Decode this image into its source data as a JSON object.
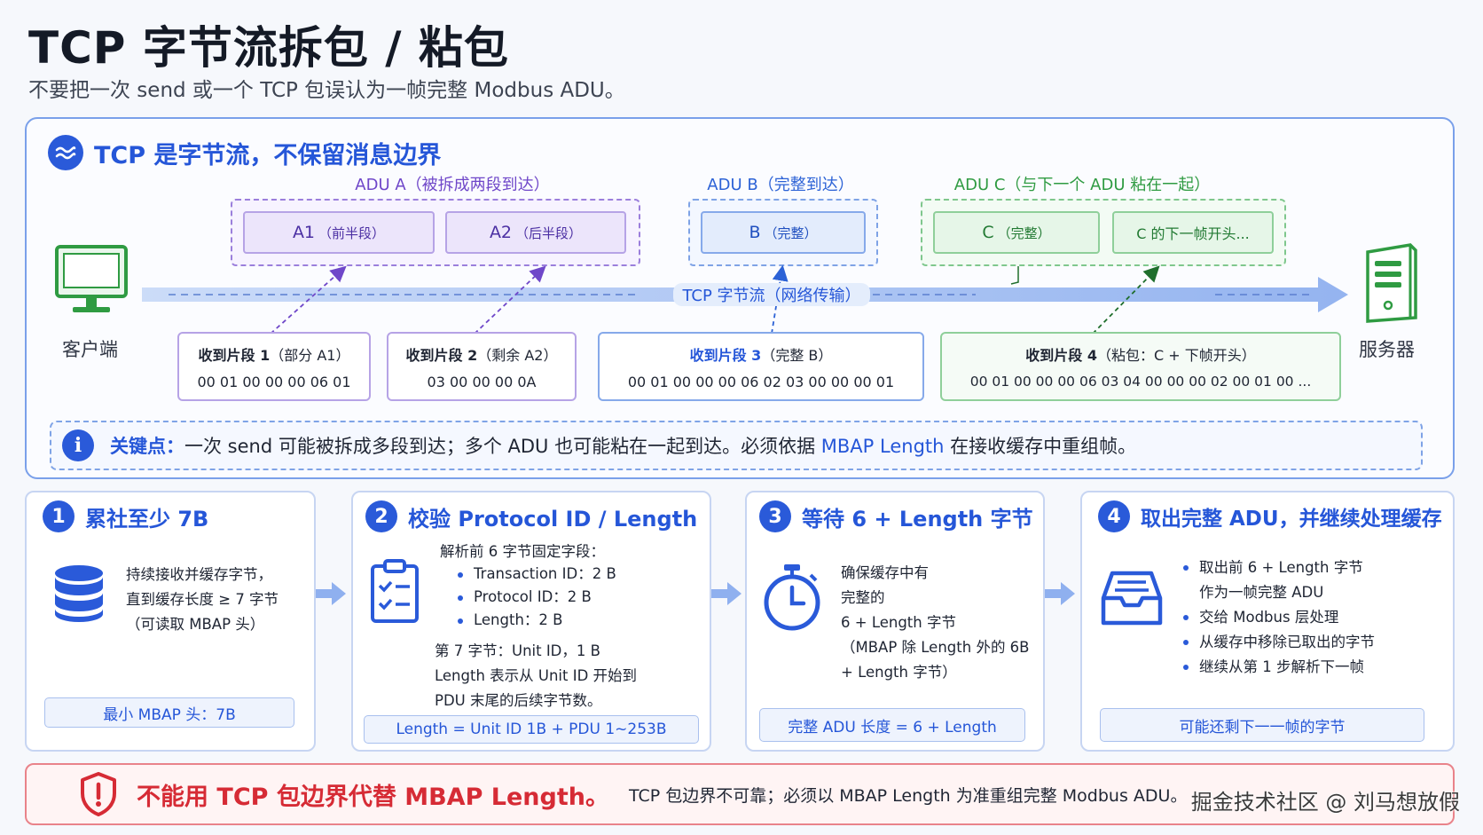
{
  "title": "TCP 字节流拆包 / 粘包",
  "subtitle": "不要把一次 send 或一个 TCP 包误认为一帧完整 Modbus ADU。",
  "section": {
    "title": "TCP 是字节流，不保留消息边界",
    "icon": "wave-icon"
  },
  "client_label": "客户端",
  "server_label": "服务器",
  "stream_label": "TCP 字节流（网络传输）",
  "groups": [
    {
      "label": "ADU A（被拆成两段到达）",
      "color": "#6f47c9",
      "packets": [
        {
          "name": "A1",
          "note": "（前半段）"
        },
        {
          "name": "A2",
          "note": "（后半段）"
        }
      ]
    },
    {
      "label": "ADU B（完整到达）",
      "color": "#2c62d6",
      "packets": [
        {
          "name": "B",
          "note": "（完整）"
        }
      ]
    },
    {
      "label": "ADU C（与下一个 ADU 粘在一起）",
      "color": "#2f9b42",
      "packets": [
        {
          "name": "C",
          "note": "（完整）"
        },
        {
          "name": "C 的下一帧开头...",
          "note": ""
        }
      ]
    }
  ],
  "fragments": [
    {
      "label": "收到片段 1",
      "desc": "（部分 A1）",
      "hex": "00 01 00 00 00 06 01",
      "color": "#6f47c9"
    },
    {
      "label": "收到片段 2",
      "desc": "（剩余 A2）",
      "hex": "03 00 00 00 0A",
      "color": "#6f47c9"
    },
    {
      "label": "收到片段 3",
      "desc": "（完整 B）",
      "hex": "00 01 00 00 00 06 02 03 00 00 00 01",
      "color": "#2c62d6"
    },
    {
      "label": "收到片段 4",
      "desc": "（粘包：C + 下帧开头）",
      "hex": "00 01 00 00 00 06 03 04 00 00 00 02 00 01 00 ...",
      "color": "#2f9b42"
    }
  ],
  "key_point": {
    "label": "关键点：",
    "text_before": "一次 send 可能被拆成多段到达；多个 ADU 也可能粘在一起到达。必须依据 ",
    "highlight": "MBAP Length",
    "text_after": " 在接收缓存中重组帧。"
  },
  "steps": [
    {
      "num": "1",
      "title": "累社至少 7B",
      "icon": "database-icon",
      "lines": [
        "持续接收并缓存字节，",
        "直到缓存长度 ≥ 7 字节",
        "（可读取 MBAP 头）"
      ],
      "note": "最小 MBAP 头：7B"
    },
    {
      "num": "2",
      "title": "校验 Protocol ID / Length",
      "icon": "clipboard-check-icon",
      "intro": "解析前 6 字节固定字段：",
      "bullets": [
        "Transaction ID：2 B",
        "Protocol ID：2 B",
        "Length：2 B"
      ],
      "lines": [
        "第 7 字节：Unit ID，1 B",
        "Length 表示从 Unit ID 开始到",
        "PDU 末尾的后续字节数。"
      ],
      "note": "Length = Unit ID 1B + PDU 1~253B"
    },
    {
      "num": "3",
      "title": "等待 6 + Length 字节",
      "icon": "stopwatch-icon",
      "lines": [
        "确保缓存中有",
        "完整的",
        "6 + Length 字节",
        "（MBAP 除 Length 外的 6B",
        "+ Length 字节）"
      ],
      "note": "完整 ADU 长度 = 6 + Length"
    },
    {
      "num": "4",
      "title": "取出完整 ADU，并继续处理缓存",
      "icon": "inbox-tray-icon",
      "bullets": [
        "取出前 6 + Length 字节",
        "交给 Modbus 层处理",
        "从缓存中移除已取出的字节",
        "继续从第 1 步解析下一帧"
      ],
      "bullet_cont": "作为一帧完整 ADU",
      "note": "可能还剩下一一帧的字节"
    }
  ],
  "warning": {
    "icon": "shield-alert-icon",
    "main": "不能用 TCP 包边界代替 MBAP Length。",
    "sub": "TCP 包边界不可靠；必须以 MBAP Length 为准重组完整 Modbus ADU。"
  },
  "watermark": "掘金技术社区 @ 刘马想放假",
  "colors": {
    "accent": "#2a5ad9",
    "purple": "#6f47c9",
    "green": "#2f9b42",
    "red": "#d62b35"
  }
}
